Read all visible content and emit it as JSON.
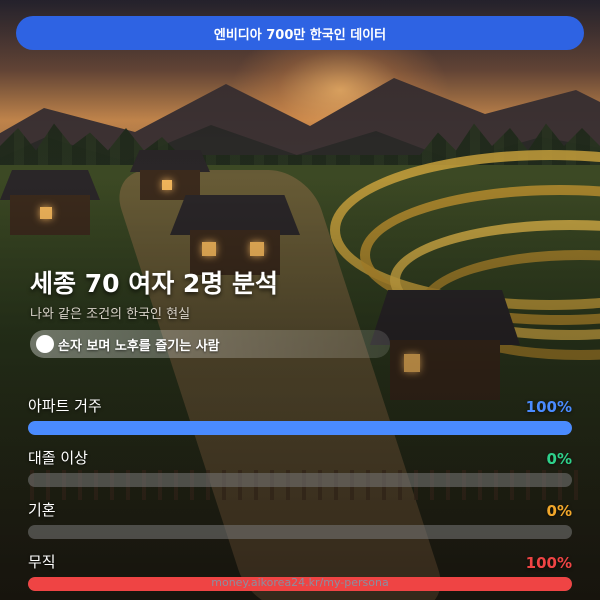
{
  "banner": {
    "label": "엔비디아 700만 한국인 데이터"
  },
  "title": "세종 70 여자 2명 분석",
  "subtitle": "나와 같은 조건의 한국인 현실",
  "persona": {
    "label": "손자 보며 노후를 즐기는 사람"
  },
  "stats": [
    {
      "label": "아파트 거주",
      "value": "100%",
      "fraction": 1.0,
      "color": "#4a8bff"
    },
    {
      "label": "대졸 이상",
      "value": "0%",
      "fraction": 0.0,
      "color": "#2ed08a"
    },
    {
      "label": "기혼",
      "value": "0%",
      "fraction": 0.0,
      "color": "#f0a62a"
    },
    {
      "label": "무직",
      "value": "100%",
      "fraction": 1.0,
      "color": "#ef4444"
    }
  ],
  "footer": {
    "url": "money.aikorea24.kr/my-persona"
  }
}
